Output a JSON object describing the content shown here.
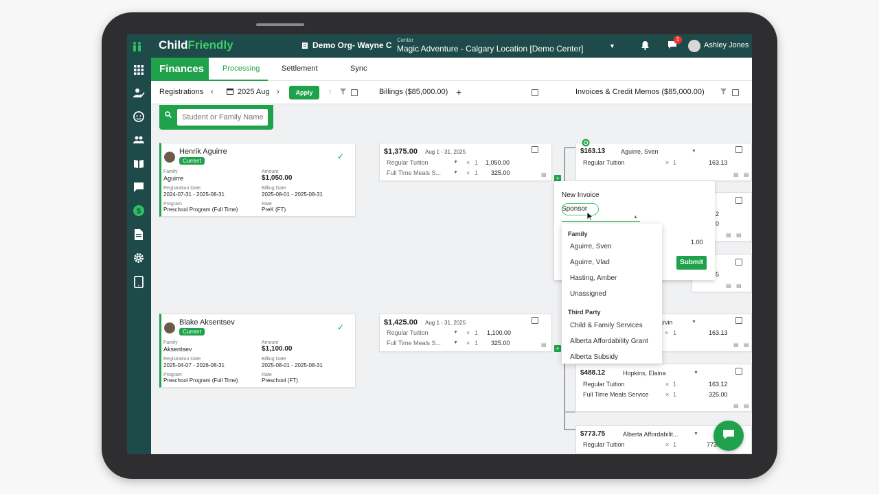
{
  "app": {
    "brand_prefix": "Child",
    "brand_suffix": "Friendly",
    "org": "Demo Org- Wayne C",
    "center_label": "Center",
    "center_value": "Magic Adventure - Calgary Location [Demo Center]",
    "chat_badge": "1",
    "user": "Ashley Jones"
  },
  "nav": {
    "section": "Finances",
    "tabs": [
      "Processing",
      "Settlement",
      "Sync"
    ]
  },
  "toolbar": {
    "registrations": "Registrations",
    "period": "2025 Aug",
    "apply": "Apply",
    "billings": "Billings ($85,000.00)",
    "invoices": "Invoices & Credit Memos ($85,000.00)"
  },
  "search": {
    "placeholder": "Student or Family Name"
  },
  "labels": {
    "family": "Family",
    "amount": "Amount",
    "registration_date": "Registration Date",
    "billing_date": "Billing Date",
    "program": "Program",
    "rate": "Rate",
    "x": "×"
  },
  "registrations": [
    {
      "name": "Henrik Aguirre",
      "status": "Current",
      "family": "Aguirre",
      "amount": "$1,050.00",
      "registration_date": "2024-07-31 - 2025-08-31",
      "billing_date": "2025-08-01 - 2025-08-31",
      "program": "Preschool Program (Full Time)",
      "rate": "PreK (FT)"
    },
    {
      "name": "Blake Aksentsev",
      "status": "Current",
      "family": "Aksentsev",
      "amount": "$1,100.00",
      "registration_date": "2025-04-07 - 2026-08-31",
      "billing_date": "2025-08-01 - 2025-08-31",
      "program": "Preschool Program (Full Time)",
      "rate": "Preschool (FT)"
    }
  ],
  "billings": [
    {
      "amount": "$1,375.00",
      "range": "Aug 1 - 31, 2025",
      "lines": [
        {
          "desc": "Regular Tuition",
          "qty": "1",
          "amt": "1,050.00"
        },
        {
          "desc": "Full Time Meals S...",
          "qty": "1",
          "amt": "325.00"
        }
      ]
    },
    {
      "amount": "$1,425.00",
      "range": "Aug 1 - 31, 2025",
      "lines": [
        {
          "desc": "Regular Tuition",
          "qty": "1",
          "amt": "1,100.00"
        },
        {
          "desc": "Full Time Meals S...",
          "qty": "1",
          "amt": "325.00"
        }
      ]
    }
  ],
  "invoices": {
    "first": {
      "amount": "$163.13",
      "name": "Aguirre, Sven",
      "line": "Regular Tuition",
      "qty": "1",
      "amt": "163.13"
    },
    "partial_a": "2",
    "partial_b": "0",
    "partial_c": "5",
    "marvin": {
      "name": "arvin",
      "qty": "1",
      "amt": "163.13"
    },
    "hopkins": {
      "amount": "$488.12",
      "name": "Hopkins, Elaina",
      "lines": [
        {
          "desc": "Regular Tuition",
          "qty": "1",
          "amt": "163.12"
        },
        {
          "desc": "Full Time Meals Service",
          "qty": "1",
          "amt": "325.00"
        }
      ]
    },
    "alberta": {
      "amount": "$773.75",
      "name": "Alberta Affordabilit...",
      "line": "Regular Tuition",
      "qty": "1",
      "amt": "773.75"
    }
  },
  "popup": {
    "new_invoice": "New Invoice",
    "sponsor": "Sponsor",
    "qty": "1.00",
    "submit": "Submit"
  },
  "dropdown": {
    "family_header": "Family",
    "family": [
      "Aguirre, Sven",
      "Aguirre, Vlad",
      "Hasting, Amber",
      "Unassigned"
    ],
    "third_party_header": "Third Party",
    "third_party": [
      "Child & Family Services",
      "Alberta Affordability Grant",
      "Alberta Subsidy"
    ]
  },
  "colors": {
    "accent": "#1fa24b",
    "nav_bg": "#1f4a4a"
  }
}
